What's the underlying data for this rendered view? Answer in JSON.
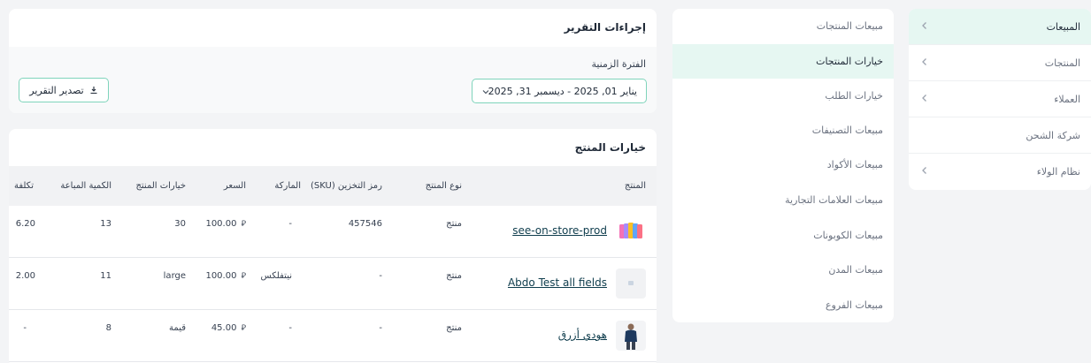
{
  "sidebar": {
    "items": [
      {
        "label": "المبيعات",
        "active": true,
        "has_chevron": true
      },
      {
        "label": "المنتجات",
        "active": false,
        "has_chevron": true
      },
      {
        "label": "العملاء",
        "active": false,
        "has_chevron": true
      },
      {
        "label": "شركة الشحن",
        "active": false,
        "has_chevron": false
      },
      {
        "label": "نظام الولاء",
        "active": false,
        "has_chevron": true
      }
    ]
  },
  "reports_menu": {
    "items": [
      {
        "label": "مبيعات المنتجات",
        "active": false
      },
      {
        "label": "خيارات المنتجات",
        "active": true
      },
      {
        "label": "خيارات الطلب",
        "active": false
      },
      {
        "label": "مبيعات التصنيفات",
        "active": false
      },
      {
        "label": "مبيعات الأكواد",
        "active": false
      },
      {
        "label": "مبيعات العلامات التجارية",
        "active": false
      },
      {
        "label": "مبيعات الكوبونات",
        "active": false
      },
      {
        "label": "مبيعات المدن",
        "active": false
      },
      {
        "label": "مبيعات الفروع",
        "active": false
      }
    ]
  },
  "report_actions": {
    "title": "إجراءات التقرير",
    "period_label": "الفترة الزمنية",
    "date_range": "يناير 01, 2025  -  ديسمبر 31, 2025",
    "export_label": "تصدير التقرير"
  },
  "table": {
    "title": "خيارات المنتج",
    "headers": {
      "product": "المنتج",
      "type": "نوع المنتج",
      "sku": "رمز التخزين (SKU)",
      "brand": "الماركة",
      "price": "السعر",
      "options": "خيارات المنتج",
      "qty": "الكمية المباعة",
      "cost": "تكلفة"
    },
    "currency_symbol": "⃁",
    "rows": [
      {
        "name": "see-on-store-prod",
        "type": "منتج",
        "sku": "457546",
        "brand": "-",
        "price": "100.00",
        "options": "30",
        "qty": "13",
        "cost": "6.20",
        "thumb": "phones"
      },
      {
        "name": "Abdo Test all fields",
        "type": "منتج",
        "sku": "-",
        "brand": "نيتفلكس",
        "price": "100.00",
        "options": "large",
        "qty": "11",
        "cost": "2.00",
        "thumb": "placeholder"
      },
      {
        "name": "هودي أزرق",
        "type": "منتج",
        "sku": "-",
        "brand": "-",
        "price": "45.00",
        "options": "قيمة",
        "qty": "8",
        "cost": "-",
        "thumb": "person"
      }
    ]
  },
  "colors": {
    "accent": "#7fd4bb",
    "active_bg": "#e6f7f2",
    "link": "#0f3d4d"
  }
}
